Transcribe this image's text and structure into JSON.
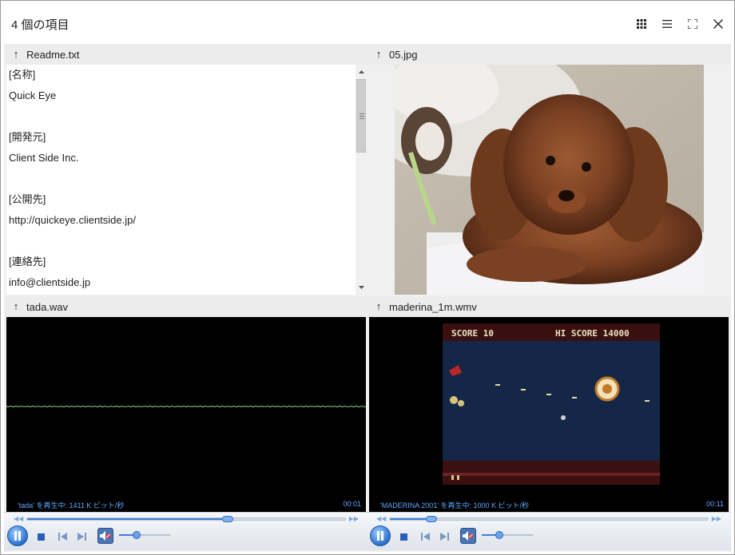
{
  "window": {
    "title": "4 個の項目"
  },
  "toolbar": {
    "icons": [
      "grid-icon",
      "list-icon",
      "fullscreen-icon",
      "close-icon"
    ]
  },
  "panes": {
    "readme": {
      "filename": "Readme.txt",
      "lines": [
        "[名称]",
        "Quick Eye",
        "",
        "[開発元]",
        "Client Side Inc.",
        "",
        "[公開先]",
        "http://quickeye.clientside.jp/",
        "",
        "[連絡先]",
        "info@clientside.jp"
      ]
    },
    "image": {
      "filename": "05.jpg"
    },
    "audio": {
      "filename": "tada.wav",
      "status": "'tada' を再生中: 1411 K ビット/秒",
      "time": "00:01",
      "progress": 0.63,
      "volume": 0.35
    },
    "video": {
      "filename": "maderina_1m.wmv",
      "status": "'MADERINA 2001' を再生中: 1000 K ビット/秒",
      "time": "00:11",
      "progress": 0.13,
      "volume": 0.35,
      "game_text": {
        "score": "SCORE 10",
        "hi_score": "HI SCORE 14000"
      }
    }
  },
  "colors": {
    "accent": "#3e7ee0",
    "status_text": "#5fa7ff",
    "waveform": "#8fd48f"
  }
}
